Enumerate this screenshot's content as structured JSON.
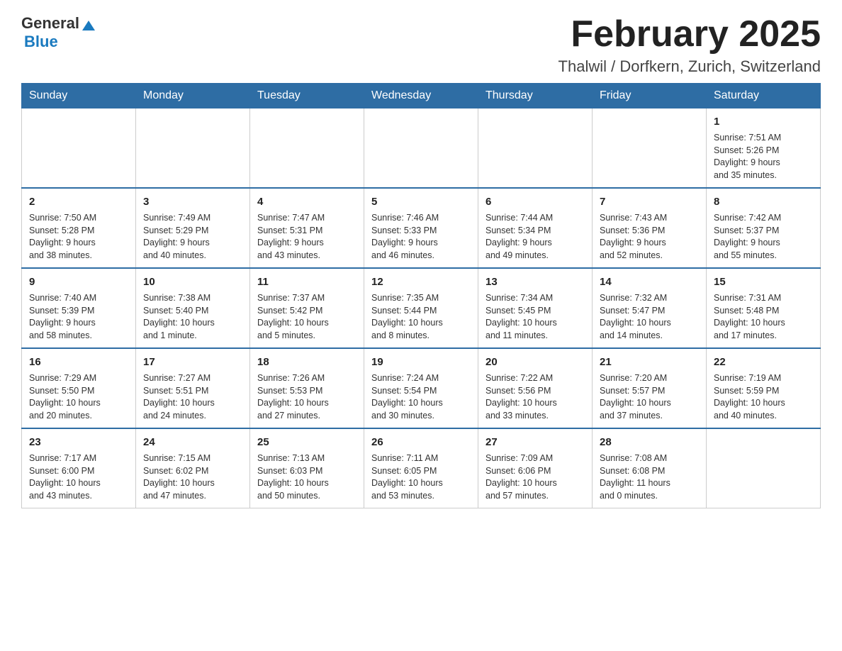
{
  "header": {
    "logo": {
      "general": "General",
      "triangle": "▲",
      "blue": "Blue"
    },
    "title": "February 2025",
    "location": "Thalwil / Dorfkern, Zurich, Switzerland"
  },
  "weekdays": [
    "Sunday",
    "Monday",
    "Tuesday",
    "Wednesday",
    "Thursday",
    "Friday",
    "Saturday"
  ],
  "weeks": [
    [
      {
        "day": "",
        "info": ""
      },
      {
        "day": "",
        "info": ""
      },
      {
        "day": "",
        "info": ""
      },
      {
        "day": "",
        "info": ""
      },
      {
        "day": "",
        "info": ""
      },
      {
        "day": "",
        "info": ""
      },
      {
        "day": "1",
        "info": "Sunrise: 7:51 AM\nSunset: 5:26 PM\nDaylight: 9 hours\nand 35 minutes."
      }
    ],
    [
      {
        "day": "2",
        "info": "Sunrise: 7:50 AM\nSunset: 5:28 PM\nDaylight: 9 hours\nand 38 minutes."
      },
      {
        "day": "3",
        "info": "Sunrise: 7:49 AM\nSunset: 5:29 PM\nDaylight: 9 hours\nand 40 minutes."
      },
      {
        "day": "4",
        "info": "Sunrise: 7:47 AM\nSunset: 5:31 PM\nDaylight: 9 hours\nand 43 minutes."
      },
      {
        "day": "5",
        "info": "Sunrise: 7:46 AM\nSunset: 5:33 PM\nDaylight: 9 hours\nand 46 minutes."
      },
      {
        "day": "6",
        "info": "Sunrise: 7:44 AM\nSunset: 5:34 PM\nDaylight: 9 hours\nand 49 minutes."
      },
      {
        "day": "7",
        "info": "Sunrise: 7:43 AM\nSunset: 5:36 PM\nDaylight: 9 hours\nand 52 minutes."
      },
      {
        "day": "8",
        "info": "Sunrise: 7:42 AM\nSunset: 5:37 PM\nDaylight: 9 hours\nand 55 minutes."
      }
    ],
    [
      {
        "day": "9",
        "info": "Sunrise: 7:40 AM\nSunset: 5:39 PM\nDaylight: 9 hours\nand 58 minutes."
      },
      {
        "day": "10",
        "info": "Sunrise: 7:38 AM\nSunset: 5:40 PM\nDaylight: 10 hours\nand 1 minute."
      },
      {
        "day": "11",
        "info": "Sunrise: 7:37 AM\nSunset: 5:42 PM\nDaylight: 10 hours\nand 5 minutes."
      },
      {
        "day": "12",
        "info": "Sunrise: 7:35 AM\nSunset: 5:44 PM\nDaylight: 10 hours\nand 8 minutes."
      },
      {
        "day": "13",
        "info": "Sunrise: 7:34 AM\nSunset: 5:45 PM\nDaylight: 10 hours\nand 11 minutes."
      },
      {
        "day": "14",
        "info": "Sunrise: 7:32 AM\nSunset: 5:47 PM\nDaylight: 10 hours\nand 14 minutes."
      },
      {
        "day": "15",
        "info": "Sunrise: 7:31 AM\nSunset: 5:48 PM\nDaylight: 10 hours\nand 17 minutes."
      }
    ],
    [
      {
        "day": "16",
        "info": "Sunrise: 7:29 AM\nSunset: 5:50 PM\nDaylight: 10 hours\nand 20 minutes."
      },
      {
        "day": "17",
        "info": "Sunrise: 7:27 AM\nSunset: 5:51 PM\nDaylight: 10 hours\nand 24 minutes."
      },
      {
        "day": "18",
        "info": "Sunrise: 7:26 AM\nSunset: 5:53 PM\nDaylight: 10 hours\nand 27 minutes."
      },
      {
        "day": "19",
        "info": "Sunrise: 7:24 AM\nSunset: 5:54 PM\nDaylight: 10 hours\nand 30 minutes."
      },
      {
        "day": "20",
        "info": "Sunrise: 7:22 AM\nSunset: 5:56 PM\nDaylight: 10 hours\nand 33 minutes."
      },
      {
        "day": "21",
        "info": "Sunrise: 7:20 AM\nSunset: 5:57 PM\nDaylight: 10 hours\nand 37 minutes."
      },
      {
        "day": "22",
        "info": "Sunrise: 7:19 AM\nSunset: 5:59 PM\nDaylight: 10 hours\nand 40 minutes."
      }
    ],
    [
      {
        "day": "23",
        "info": "Sunrise: 7:17 AM\nSunset: 6:00 PM\nDaylight: 10 hours\nand 43 minutes."
      },
      {
        "day": "24",
        "info": "Sunrise: 7:15 AM\nSunset: 6:02 PM\nDaylight: 10 hours\nand 47 minutes."
      },
      {
        "day": "25",
        "info": "Sunrise: 7:13 AM\nSunset: 6:03 PM\nDaylight: 10 hours\nand 50 minutes."
      },
      {
        "day": "26",
        "info": "Sunrise: 7:11 AM\nSunset: 6:05 PM\nDaylight: 10 hours\nand 53 minutes."
      },
      {
        "day": "27",
        "info": "Sunrise: 7:09 AM\nSunset: 6:06 PM\nDaylight: 10 hours\nand 57 minutes."
      },
      {
        "day": "28",
        "info": "Sunrise: 7:08 AM\nSunset: 6:08 PM\nDaylight: 11 hours\nand 0 minutes."
      },
      {
        "day": "",
        "info": ""
      }
    ]
  ]
}
